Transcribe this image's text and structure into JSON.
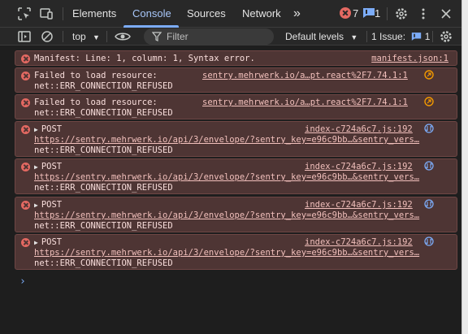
{
  "tabs": [
    {
      "label": "Elements"
    },
    {
      "label": "Console"
    },
    {
      "label": "Sources"
    },
    {
      "label": "Network"
    }
  ],
  "more_tabs_glyph": "»",
  "badges": {
    "errors": "7",
    "messages": "1"
  },
  "toolbar": {
    "context": "top",
    "filter_placeholder": "Filter",
    "levels": "Default levels",
    "issues_label": "1 Issue:",
    "issues_count": "1"
  },
  "colors": {
    "accent": "#a8c7fa",
    "error": "#e46962",
    "error_bg": "#4e3534"
  },
  "messages": [
    {
      "text": "Manifest: Line: 1, column: 1, Syntax error.",
      "source": "manifest.json:1"
    },
    {
      "text": "Failed to load resource:",
      "detail": "net::ERR_CONNECTION_REFUSED",
      "source": "sentry.mehrwerk.io/a…pt.react%2F7.74.1:1",
      "icon": "origin-icon"
    },
    {
      "text": "Failed to load resource:",
      "detail": "net::ERR_CONNECTION_REFUSED",
      "source": "sentry.mehrwerk.io/a…pt.react%2F7.74.1:1",
      "icon": "origin-icon"
    },
    {
      "method": "POST",
      "url": "https://sentry.mehrwerk.io/api/3/envelope/?sentry_key=e96c9bb…&sentry_vers…",
      "detail": "net::ERR_CONNECTION_REFUSED",
      "source": "index-c724a6c7.js:192",
      "icon": "network-icon"
    },
    {
      "method": "POST",
      "url": "https://sentry.mehrwerk.io/api/3/envelope/?sentry_key=e96c9bb…&sentry_vers…",
      "detail": "net::ERR_CONNECTION_REFUSED",
      "source": "index-c724a6c7.js:192",
      "icon": "network-icon"
    },
    {
      "method": "POST",
      "url": "https://sentry.mehrwerk.io/api/3/envelope/?sentry_key=e96c9bb…&sentry_vers…",
      "detail": "net::ERR_CONNECTION_REFUSED",
      "source": "index-c724a6c7.js:192",
      "icon": "network-icon"
    },
    {
      "method": "POST",
      "url": "https://sentry.mehrwerk.io/api/3/envelope/?sentry_key=e96c9bb…&sentry_vers…",
      "detail": "net::ERR_CONNECTION_REFUSED",
      "source": "index-c724a6c7.js:192",
      "icon": "network-icon"
    }
  ],
  "prompt_glyph": "›"
}
